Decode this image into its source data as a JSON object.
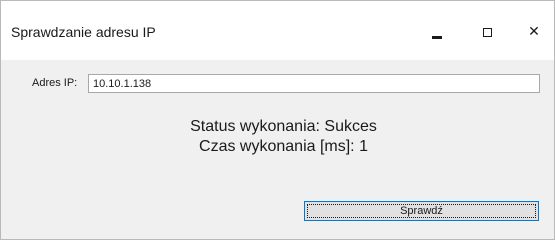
{
  "window": {
    "title": "Sprawdzanie adresu IP",
    "minimize_icon": "minimize-icon",
    "maximize_icon": "maximize-icon",
    "close_icon": "close-icon",
    "close_glyph": "✕"
  },
  "form": {
    "ip_label": "Adres IP:",
    "ip_value": "10.10.1.138"
  },
  "result": {
    "status_line": "Status wykonania: Sukces",
    "time_line": "Czas wykonania [ms]: 1"
  },
  "actions": {
    "check_label": "Sprawdź"
  },
  "colors": {
    "focus_border": "#0078d7",
    "button_face": "#e1e1e1",
    "window_bg": "#f0f0f0",
    "titlebar_bg": "#ffffff"
  }
}
